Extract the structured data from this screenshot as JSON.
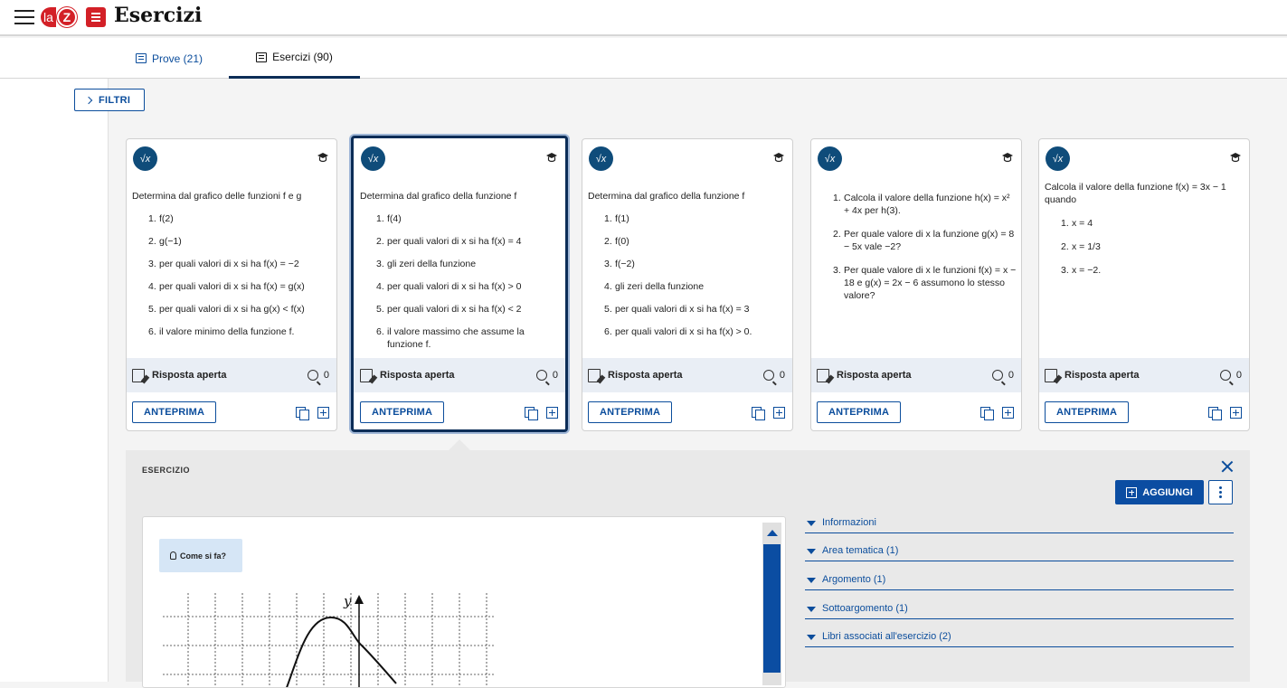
{
  "app": {
    "title": "Esercizi",
    "logo_la": "la",
    "logo_z": "Z"
  },
  "tabs": [
    {
      "label": "Prove (21)",
      "active": false
    },
    {
      "label": "Esercizi (90)",
      "active": true
    }
  ],
  "filters": {
    "label": "FILTRI"
  },
  "cards": [
    {
      "badge": "√x",
      "intro": "Determina dal grafico delle funzioni f e g",
      "items": [
        "f(2)",
        "g(−1)",
        "per quali valori di x si ha f(x) = −2",
        "per quali valori di x si ha f(x) = g(x)",
        "per quali valori di x si ha g(x) < f(x)",
        "il valore minimo della funzione f."
      ],
      "answer_type": "Risposta aperta",
      "views": "0",
      "preview": "ANTEPRIMA"
    },
    {
      "badge": "√x",
      "intro": "Determina dal grafico della funzione f",
      "items": [
        "f(4)",
        "per quali valori di x si ha f(x) = 4",
        "gli zeri della funzione",
        "per quali valori di x si ha f(x) > 0",
        "per quali valori di x si ha f(x) < 2",
        "il valore massimo che assume la funzione f."
      ],
      "answer_type": "Risposta aperta",
      "views": "0",
      "preview": "ANTEPRIMA"
    },
    {
      "badge": "√x",
      "intro": "Determina dal grafico della funzione f",
      "items": [
        "f(1)",
        "f(0)",
        "f(−2)",
        "gli zeri della funzione",
        "per quali valori di x si ha f(x) = 3",
        "per quali valori di x si ha f(x) > 0."
      ],
      "answer_type": "Risposta aperta",
      "views": "0",
      "preview": "ANTEPRIMA"
    },
    {
      "badge": "√x",
      "intro": "",
      "items": [
        "Calcola il valore della funzione h(x) = x² + 4x per h(3).",
        "Per quale valore di x la funzione g(x) = 8 − 5x vale −2?",
        "Per quale valore di x le funzioni f(x) = x − 18 e g(x) = 2x − 6 assumono lo stesso valore?"
      ],
      "answer_type": "Risposta aperta",
      "views": "0",
      "preview": "ANTEPRIMA"
    },
    {
      "badge": "√x",
      "intro": "Calcola il valore della funzione f(x) = 3x − 1 quando",
      "items": [
        "x = 4",
        "x = 1/3",
        "x = −2."
      ],
      "answer_type": "Risposta aperta",
      "views": "0",
      "preview": "ANTEPRIMA"
    }
  ],
  "detail": {
    "section_label": "ESERCIZIO",
    "add_label": "AGGIUNGI",
    "hint_label": "Come si fa?",
    "graph_axis_label": "y",
    "accordion": [
      "Informazioni",
      "Area tematica (1)",
      "Argomento (1)",
      "Sottoargomento (1)",
      "Libri associati all'esercizio (2)"
    ]
  },
  "colors": {
    "accent": "#0b4d9c",
    "brand_red": "#d32027",
    "badge": "#0f4c7a",
    "selected_border": "#0c2d57"
  }
}
